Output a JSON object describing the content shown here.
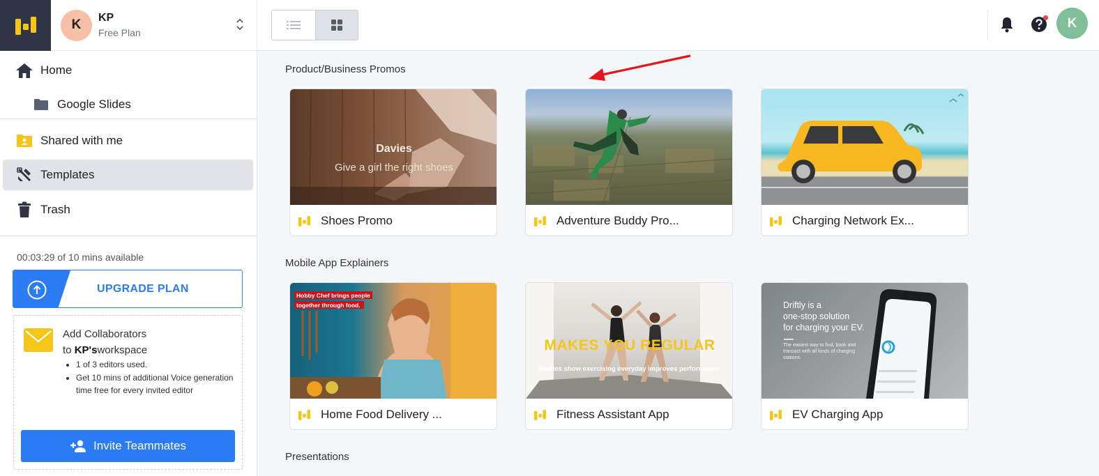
{
  "account": {
    "avatar_initial": "K",
    "name": "KP",
    "plan": "Free Plan"
  },
  "nav": {
    "home": "Home",
    "google_slides": "Google Slides",
    "shared": "Shared with me",
    "templates": "Templates",
    "trash": "Trash"
  },
  "usage": {
    "text": "00:03:29 of 10 mins available"
  },
  "upgrade": {
    "label": "UPGRADE PLAN"
  },
  "collab": {
    "title_line1": "Add Collaborators",
    "title_to": "to ",
    "title_owner": "KP's",
    "title_suffix": "workspace",
    "bullet1": "1 of 3 editors used.",
    "bullet2": "Get 10 mins of additional Voice generation time free for every invited editor",
    "invite_label": "Invite Teammates"
  },
  "topbar": {
    "user_initial": "K"
  },
  "sections": {
    "product": "Product/Business Promos",
    "mobile": "Mobile App Explainers",
    "presentations": "Presentations"
  },
  "cards": [
    {
      "label": "Shoes Promo",
      "thumb_title": "Davies",
      "thumb_sub": "Give a girl the right shoes"
    },
    {
      "label": "Adventure Buddy Pro..."
    },
    {
      "label": "Charging Network Ex..."
    },
    {
      "label": "Home Food Delivery ...",
      "thumb_line1": "Hobby Chef brings people",
      "thumb_line2": "together through food."
    },
    {
      "label": "Fitness Assistant App",
      "thumb_title": "MAKES YOU REGULAR",
      "thumb_sub": "Studies show exercising everyday  improves performance."
    },
    {
      "label": "EV Charging App",
      "thumb_l1": "Driftly is a",
      "thumb_l2": "one-stop solution",
      "thumb_l3": "for charging your EV.",
      "thumb_small": "The easiest way to find, book and transact with all kinds of charging stations."
    }
  ],
  "colors": {
    "accent": "#2b7bf5",
    "brand_dark": "#2f3544",
    "brand_yellow": "#f5c518",
    "active_nav": "#e1e3e8"
  }
}
